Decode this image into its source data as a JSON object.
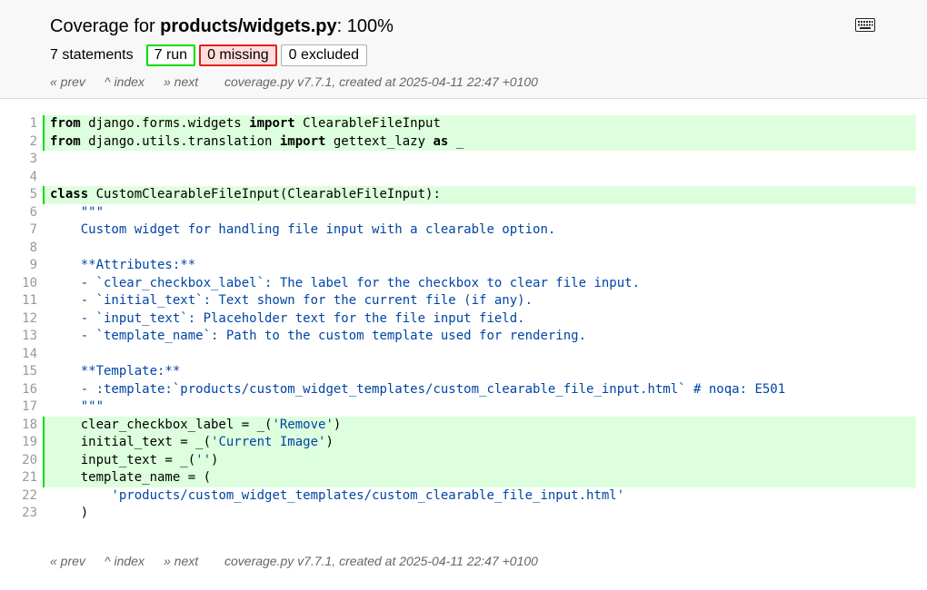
{
  "header": {
    "title_prefix": "Coverage for ",
    "title_file": "products/widgets.py",
    "title_suffix": ": 100%",
    "statements": "7 statements",
    "run_label": "7 run",
    "missing_label": "0 missing",
    "excluded_label": "0 excluded",
    "keyboard_icon": "keyboard-icon"
  },
  "nav": {
    "prev": "« prev",
    "index": "^ index",
    "next": "» next",
    "info": "coverage.py v7.7.1, created at 2025-04-11 22:47 +0100"
  },
  "colors": {
    "run_bg": "#ddffdd",
    "run_border": "#00dd00",
    "missing_bg": "#ffdddd",
    "missing_border": "#dd2222",
    "string": "#0045a5"
  },
  "source": [
    {
      "n": "1",
      "run": true,
      "tokens": [
        [
          "k",
          "from"
        ],
        [
          "p",
          " django.forms.widgets "
        ],
        [
          "k",
          "import"
        ],
        [
          "p",
          " ClearableFileInput"
        ]
      ]
    },
    {
      "n": "2",
      "run": true,
      "tokens": [
        [
          "k",
          "from"
        ],
        [
          "p",
          " django.utils.translation "
        ],
        [
          "k",
          "import"
        ],
        [
          "p",
          " gettext_lazy "
        ],
        [
          "k",
          "as"
        ],
        [
          "p",
          " _"
        ]
      ]
    },
    {
      "n": "3",
      "run": false,
      "tokens": []
    },
    {
      "n": "4",
      "run": false,
      "tokens": []
    },
    {
      "n": "5",
      "run": true,
      "tokens": [
        [
          "k",
          "class"
        ],
        [
          "p",
          " CustomClearableFileInput(ClearableFileInput):"
        ]
      ]
    },
    {
      "n": "6",
      "run": false,
      "tokens": [
        [
          "p",
          "    "
        ],
        [
          "doc",
          "\"\"\""
        ]
      ]
    },
    {
      "n": "7",
      "run": false,
      "tokens": [
        [
          "p",
          "    "
        ],
        [
          "doc",
          "Custom widget for handling file input with a clearable option."
        ]
      ]
    },
    {
      "n": "8",
      "run": false,
      "tokens": []
    },
    {
      "n": "9",
      "run": false,
      "tokens": [
        [
          "p",
          "    "
        ],
        [
          "doc",
          "**Attributes:**"
        ]
      ]
    },
    {
      "n": "10",
      "run": false,
      "tokens": [
        [
          "p",
          "    "
        ],
        [
          "doc",
          "- `clear_checkbox_label`: The label for the checkbox to clear file input."
        ]
      ]
    },
    {
      "n": "11",
      "run": false,
      "tokens": [
        [
          "p",
          "    "
        ],
        [
          "doc",
          "- `initial_text`: Text shown for the current file (if any)."
        ]
      ]
    },
    {
      "n": "12",
      "run": false,
      "tokens": [
        [
          "p",
          "    "
        ],
        [
          "doc",
          "- `input_text`: Placeholder text for the file input field."
        ]
      ]
    },
    {
      "n": "13",
      "run": false,
      "tokens": [
        [
          "p",
          "    "
        ],
        [
          "doc",
          "- `template_name`: Path to the custom template used for rendering."
        ]
      ]
    },
    {
      "n": "14",
      "run": false,
      "tokens": []
    },
    {
      "n": "15",
      "run": false,
      "tokens": [
        [
          "p",
          "    "
        ],
        [
          "doc",
          "**Template:**"
        ]
      ]
    },
    {
      "n": "16",
      "run": false,
      "tokens": [
        [
          "p",
          "    "
        ],
        [
          "doc",
          "- :template:`products/custom_widget_templates/custom_clearable_file_input.html` # noqa: E501"
        ]
      ]
    },
    {
      "n": "17",
      "run": false,
      "tokens": [
        [
          "p",
          "    "
        ],
        [
          "doc",
          "\"\"\""
        ]
      ]
    },
    {
      "n": "18",
      "run": true,
      "tokens": [
        [
          "p",
          "    clear_checkbox_label = _("
        ],
        [
          "s",
          "'Remove'"
        ],
        [
          "p",
          ")"
        ]
      ]
    },
    {
      "n": "19",
      "run": true,
      "tokens": [
        [
          "p",
          "    initial_text = _("
        ],
        [
          "s",
          "'Current Image'"
        ],
        [
          "p",
          ")"
        ]
      ]
    },
    {
      "n": "20",
      "run": true,
      "tokens": [
        [
          "p",
          "    input_text = _("
        ],
        [
          "s",
          "''"
        ],
        [
          "p",
          ")"
        ]
      ]
    },
    {
      "n": "21",
      "run": true,
      "tokens": [
        [
          "p",
          "    template_name = ("
        ]
      ]
    },
    {
      "n": "22",
      "run": false,
      "tokens": [
        [
          "p",
          "        "
        ],
        [
          "s",
          "'products/custom_widget_templates/custom_clearable_file_input.html'"
        ]
      ]
    },
    {
      "n": "23",
      "run": false,
      "tokens": [
        [
          "p",
          "    )"
        ]
      ]
    }
  ]
}
